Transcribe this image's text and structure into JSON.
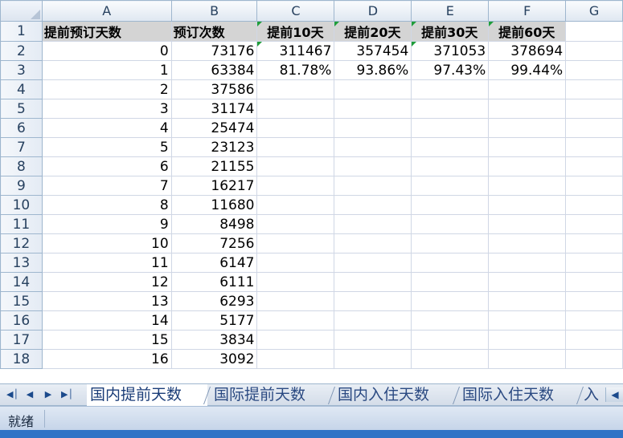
{
  "columns": [
    "A",
    "B",
    "C",
    "D",
    "E",
    "F",
    "G"
  ],
  "rows": [
    {
      "num": "1",
      "cells": [
        "提前预订天数",
        "预订次数",
        "提前10天",
        "提前20天",
        "提前30天",
        "提前60天",
        ""
      ]
    },
    {
      "num": "2",
      "cells": [
        "0",
        "73176",
        "311467",
        "357454",
        "371053",
        "378694",
        ""
      ]
    },
    {
      "num": "3",
      "cells": [
        "1",
        "63384",
        "81.78%",
        "93.86%",
        "97.43%",
        "99.44%",
        ""
      ]
    },
    {
      "num": "4",
      "cells": [
        "2",
        "37586",
        "",
        "",
        "",
        "",
        ""
      ]
    },
    {
      "num": "5",
      "cells": [
        "3",
        "31174",
        "",
        "",
        "",
        "",
        ""
      ]
    },
    {
      "num": "6",
      "cells": [
        "4",
        "25474",
        "",
        "",
        "",
        "",
        ""
      ]
    },
    {
      "num": "7",
      "cells": [
        "5",
        "23123",
        "",
        "",
        "",
        "",
        ""
      ]
    },
    {
      "num": "8",
      "cells": [
        "6",
        "21155",
        "",
        "",
        "",
        "",
        ""
      ]
    },
    {
      "num": "9",
      "cells": [
        "7",
        "16217",
        "",
        "",
        "",
        "",
        ""
      ]
    },
    {
      "num": "10",
      "cells": [
        "8",
        "11680",
        "",
        "",
        "",
        "",
        ""
      ]
    },
    {
      "num": "11",
      "cells": [
        "9",
        "8498",
        "",
        "",
        "",
        "",
        ""
      ]
    },
    {
      "num": "12",
      "cells": [
        "10",
        "7256",
        "",
        "",
        "",
        "",
        ""
      ]
    },
    {
      "num": "13",
      "cells": [
        "11",
        "6147",
        "",
        "",
        "",
        "",
        ""
      ]
    },
    {
      "num": "14",
      "cells": [
        "12",
        "6111",
        "",
        "",
        "",
        "",
        ""
      ]
    },
    {
      "num": "15",
      "cells": [
        "13",
        "6293",
        "",
        "",
        "",
        "",
        ""
      ]
    },
    {
      "num": "16",
      "cells": [
        "14",
        "5177",
        "",
        "",
        "",
        "",
        ""
      ]
    },
    {
      "num": "17",
      "cells": [
        "15",
        "3834",
        "",
        "",
        "",
        "",
        ""
      ]
    },
    {
      "num": "18",
      "cells": [
        "16",
        "3092",
        "",
        "",
        "",
        "",
        ""
      ]
    }
  ],
  "sheet_tabs": [
    "国内提前天数",
    "国际提前天数",
    "国内入住天数",
    "国际入住天数",
    "入"
  ],
  "active_tab": "国内提前天数",
  "nav_icons": [
    "first-sheet-icon",
    "prev-sheet-icon",
    "next-sheet-icon",
    "last-sheet-icon"
  ],
  "status": "就绪",
  "colors": {
    "header_fill": "#d4d4d4",
    "grid_line": "#d0d7e5",
    "heading_bg": "#dfe7f1",
    "error_flag": "#1f9d3a",
    "tab_text": "#2b4a82"
  }
}
